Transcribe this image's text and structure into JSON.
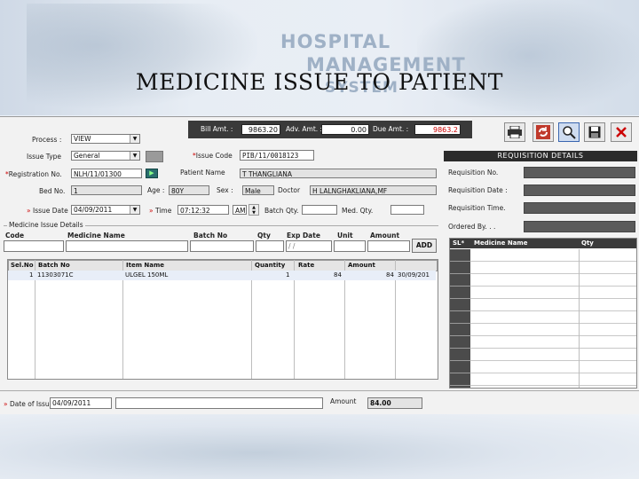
{
  "banner": {
    "brand_line1": "HOSPITAL",
    "brand_line2": "MANAGEMENT",
    "brand_line3": "SYSTEM",
    "slide_title": "MEDICINE ISSUE TO PATIENT"
  },
  "amounts": {
    "bill_label": "Bill Amt. :",
    "bill_value": "9863.20",
    "adv_label": "Adv. Amt. :",
    "adv_value": "0.00",
    "due_label": "Due Amt. :",
    "due_value": "9863.2"
  },
  "toolbar": {
    "print_icon": "printer-icon",
    "refresh_icon": "refresh-icon",
    "search_icon": "search-icon",
    "save_icon": "save-icon",
    "close_icon": "close-icon"
  },
  "form": {
    "process_label": "Process :",
    "process_value": "VIEW",
    "issue_type_label": "Issue Type",
    "issue_type_value": "General",
    "issue_code_label": "Issue Code",
    "issue_code_value": "PIB/11/0018123",
    "reg_no_label": "Registration No.",
    "reg_no_value": "NLH/11/01300",
    "patient_name_label": "Patient Name",
    "patient_name_value": "T THANGLIANA",
    "bed_no_label": "Bed No.",
    "bed_no_value": "1",
    "age_label": "Age :",
    "age_value": "80Y",
    "sex_label": "Sex :",
    "sex_value": "Male",
    "doctor_label": "Doctor",
    "doctor_value": "H LALNGHAKLIANA,MF",
    "issue_date_label": "Issue Date",
    "issue_date_value": "04/09/2011",
    "time_label": "Time",
    "time_value": "07:12:32",
    "ampm_value": "AM",
    "batch_qty_label": "Batch Qty.",
    "med_qty_label": "Med. Qty."
  },
  "medicine_issue": {
    "group_label": "Medicine Issue Details",
    "entry_headers": [
      "Code",
      "Medicine Name",
      "Batch No",
      "Qty",
      "Exp Date",
      "Unit",
      "Amount"
    ],
    "exp_date_placeholder": "/ /",
    "add_label": "ADD",
    "grid_headers": [
      "Sel.No",
      "Batch No",
      "Item Name",
      "Quantity",
      "Rate",
      "Amount",
      ""
    ],
    "rows": [
      {
        "sel": "1",
        "batch": "11303071C",
        "item": "ULGEL 150ML",
        "qty": "1",
        "rate": "84",
        "amount": "84",
        "exp": "30/09/201"
      }
    ]
  },
  "requisition": {
    "title": "REQUISITION DETAILS",
    "req_no_label": "Requisition No.",
    "req_date_label": "Requisition Date :",
    "req_time_label": "Requisition Time.",
    "ordered_by_label": "Ordered By. . .",
    "grid_headers": [
      "SL*",
      "Medicine Name",
      "Qty"
    ]
  },
  "footer": {
    "date_label": "Date of Issue",
    "date_value": "04/09/2011",
    "amount_label": "Amount",
    "amount_value": "84.00"
  }
}
